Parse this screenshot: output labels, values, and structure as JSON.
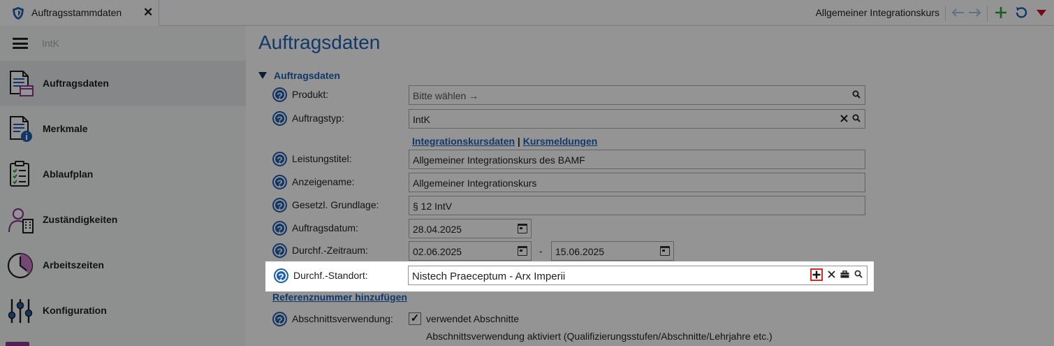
{
  "window": {
    "tab_title": "Auftragsstammdaten",
    "tab_close": "✕",
    "header_title": "Allgemeiner Integrationskurs",
    "toolbar_icons": [
      "arrow-left-icon",
      "arrow-right-icon",
      "plus-icon",
      "refresh-icon",
      "dropdown-icon"
    ]
  },
  "sidebar": {
    "menu_label": "IntK",
    "items": [
      {
        "label": "Auftragsdaten",
        "icon": "document-form-icon",
        "active": true
      },
      {
        "label": "Merkmale",
        "icon": "document-info-icon",
        "active": false
      },
      {
        "label": "Ablaufplan",
        "icon": "checklist-icon",
        "active": false
      },
      {
        "label": "Zuständigkeiten",
        "icon": "person-building-icon",
        "active": false
      },
      {
        "label": "Arbeitszeiten",
        "icon": "clock-icon",
        "active": false
      },
      {
        "label": "Konfiguration",
        "icon": "sliders-icon",
        "active": false
      }
    ]
  },
  "main": {
    "title": "Auftragsdaten",
    "section": "Auftragsdaten",
    "fields": {
      "produkt": {
        "label": "Produkt:",
        "value": "Bitte wählen →"
      },
      "auftragstyp": {
        "label": "Auftragstyp:",
        "value": "IntK"
      },
      "leistungstitel": {
        "label": "Leistungstitel:",
        "value": "Allgemeiner Integrationskurs des BAMF"
      },
      "anzeigename": {
        "label": "Anzeigename:",
        "value": "Allgemeiner Integrationskurs"
      },
      "grundlage": {
        "label": "Gesetzl. Grundlage:",
        "value": "§ 12 IntV"
      },
      "auftragsdatum": {
        "label": "Auftragsdatum:",
        "value": "28.04.2025"
      },
      "zeitraum": {
        "label": "Durchf.-Zeitraum:",
        "from": "02.06.2025",
        "separator": "-",
        "to": "15.06.2025"
      },
      "standort": {
        "label": "Durchf.-Standort:",
        "value": "Nistech Praeceptum - Arx Imperii"
      },
      "abschnitt": {
        "label": "Abschnittsverwendung:",
        "checkbox_label": "verwendet Abschnitte",
        "checked": true,
        "note": "Abschnittsverwendung aktiviert (Qualifizierungsstufen/Abschnitte/Lehrjahre etc.)"
      }
    },
    "links": {
      "integrationskursdaten": "Integrationskursdaten",
      "separator": "|",
      "kursmeldungen": "Kursmeldungen"
    },
    "reference_link": "Referenznummer hinzufügen",
    "help_glyph": "?",
    "checkmark": "✓"
  },
  "colors": {
    "accent": "#1c63b5",
    "highlight_border": "#e02424",
    "green_plus": "#2e9d3a",
    "red_triangle": "#c8102e"
  }
}
